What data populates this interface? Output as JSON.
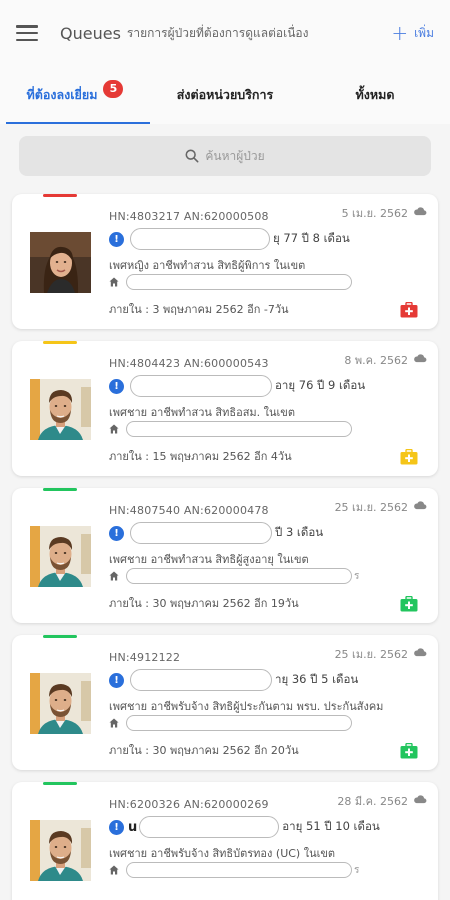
{
  "header": {
    "title": "Queues",
    "subtitle": "รายการผู้ป่วยที่ต้องการดูแลต่อเนื่อง",
    "add_label": "เพิ่ม",
    "add_symbol": "+"
  },
  "tabs": [
    {
      "label": "ที่ต้องลงเยี่ยม",
      "badge": "5"
    },
    {
      "label": "ส่งต่อหน่วยบริการ"
    },
    {
      "label": "ทั้งหมด"
    }
  ],
  "search": {
    "placeholder": "ค้นหาผู้ป่วย"
  },
  "colors": {
    "accent": "#2a6fdb",
    "badge": "#e53935",
    "kit_red": "#e53935",
    "kit_yellow": "#f5c518",
    "kit_green": "#22c55e"
  },
  "patients": [
    {
      "hn": "HN:4803217 AN:620000508",
      "date": "5 เม.ย. 2562",
      "name_prefix": "",
      "age": "ยุ 77 ปี 8 เดือน",
      "desc": "เพศหญิง อาชีพทำสวน สิทธิผู้พิการ ในเขต",
      "address_suffix": "",
      "due": "ภายใน : 3 พฤษภาคม 2562 อีก -7วัน",
      "status_color": "#e53935",
      "avatar": "female"
    },
    {
      "hn": "HN:4804423 AN:600000543",
      "date": "8 พ.ค. 2562",
      "name_prefix": "",
      "age": "อายุ 76 ปี 9 เดือน",
      "desc": "เพศชาย อาชีพทำสวน สิทธิอสม. ในเขต",
      "address_suffix": "",
      "due": "ภายใน : 15 พฤษภาคม 2562 อีก 4วัน",
      "status_color": "#f5c518",
      "avatar": "male"
    },
    {
      "hn": "HN:4807540 AN:620000478",
      "date": "25 เม.ย. 2562",
      "name_prefix": "",
      "age": "ปี 3 เดือน",
      "desc": "เพศชาย อาชีพทำสวน สิทธิผู้สูงอายุ ในเขต",
      "address_suffix": "ร",
      "due": "ภายใน : 30 พฤษภาคม 2562 อีก 19วัน",
      "status_color": "#22c55e",
      "avatar": "male"
    },
    {
      "hn": "HN:4912122",
      "date": "25 เม.ย. 2562",
      "name_prefix": "",
      "age": "ายุ 36 ปี 5 เดือน",
      "desc": "เพศชาย อาชีพรับจ้าง สิทธิผู้ประกันตาม พรบ. ประกันสังคม",
      "address_suffix": "",
      "due": "ภายใน : 30 พฤษภาคม 2562 อีก 20วัน",
      "status_color": "#22c55e",
      "avatar": "male"
    },
    {
      "hn": "HN:6200326 AN:620000269",
      "date": "28 มี.ค. 2562",
      "name_prefix": "u",
      "age": "อายุ 51 ปี 10 เดือน",
      "desc": "เพศชาย อาชีพรับจ้าง สิทธิบัตรทอง (UC) ในเขต",
      "address_suffix": "ร",
      "due": "",
      "status_color": "#22c55e",
      "avatar": "male"
    }
  ]
}
